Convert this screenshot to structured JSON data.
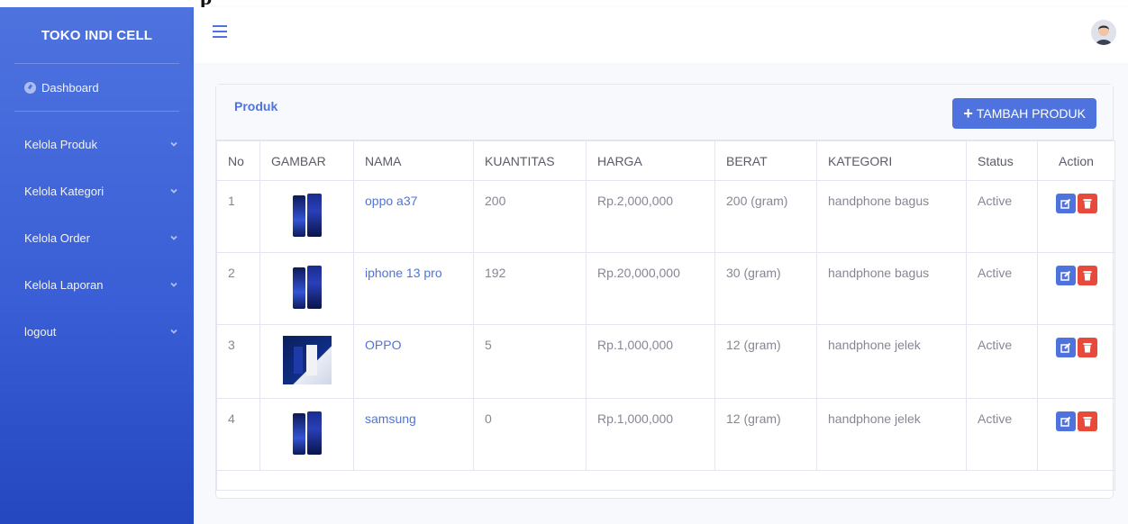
{
  "app": {
    "brand": "TOKO INDI CELL"
  },
  "sidebar": {
    "dashboard": "Dashboard",
    "items": [
      {
        "label": "Kelola Produk"
      },
      {
        "label": "Kelola Kategori"
      },
      {
        "label": "Kelola Order"
      },
      {
        "label": "Kelola Laporan"
      },
      {
        "label": "logout"
      }
    ]
  },
  "card": {
    "title": "Produk",
    "add_label": "TAMBAH PRODUK"
  },
  "table": {
    "headers": [
      "No",
      "GAMBAR",
      "NAMA",
      "KUANTITAS",
      "HARGA",
      "BERAT",
      "KATEGORI",
      "Status",
      "Action"
    ],
    "rows": [
      {
        "no": "1",
        "nama": "oppo a37",
        "kuantitas": "200",
        "harga": "Rp.2,000,000",
        "berat": "200 (gram)",
        "kategori": "handphone bagus",
        "status": "Active"
      },
      {
        "no": "2",
        "nama": "iphone 13 pro",
        "kuantitas": "192",
        "harga": "Rp.20,000,000",
        "berat": "30 (gram)",
        "kategori": "handphone bagus",
        "status": "Active"
      },
      {
        "no": "3",
        "nama": "OPPO",
        "kuantitas": "5",
        "harga": "Rp.1,000,000",
        "berat": "12 (gram)",
        "kategori": "handphone jelek",
        "status": "Active"
      },
      {
        "no": "4",
        "nama": "samsung",
        "kuantitas": "0",
        "harga": "Rp.1,000,000",
        "berat": "12 (gram)",
        "kategori": "handphone jelek",
        "status": "Active"
      }
    ]
  },
  "icons": {
    "menu": "hamburger-icon",
    "user": "user-avatar-icon",
    "edit": "edit-icon",
    "delete": "trash-icon",
    "chevron": "chevron-down-icon"
  },
  "colors": {
    "primary": "#4e73df",
    "danger": "#e74a3b"
  }
}
